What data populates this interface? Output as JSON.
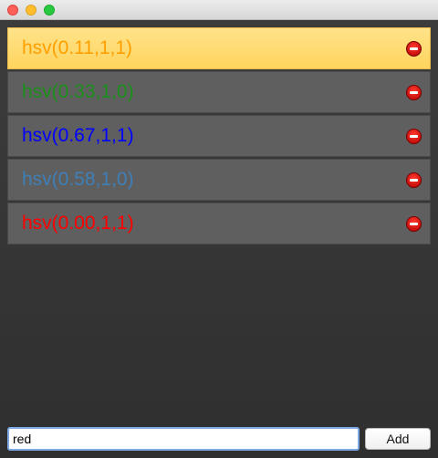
{
  "window": {
    "traffic_lights": [
      "close",
      "minimize",
      "maximize"
    ]
  },
  "list": {
    "items": [
      {
        "label": "hsv(0.11,1,1)",
        "color": "#ff9f00",
        "selected": true
      },
      {
        "label": "hsv(0.33,1,0)",
        "color": "#1a8f1a",
        "selected": false
      },
      {
        "label": "hsv(0.67,1,1)",
        "color": "#0000ff",
        "selected": false
      },
      {
        "label": "hsv(0.58,1,0)",
        "color": "#3f7fb7",
        "selected": false
      },
      {
        "label": "hsv(0.00,1,1)",
        "color": "#ff0000",
        "selected": false
      }
    ],
    "remove_icon": "minus-circle-icon"
  },
  "input": {
    "value": "red",
    "placeholder": ""
  },
  "add_button": {
    "label": "Add"
  },
  "colors": {
    "selected_bg": "#ffd45e",
    "row_bg": "#5f5f5f",
    "remove_red": "#cc0000",
    "input_focus_border": "#7da8e6"
  }
}
